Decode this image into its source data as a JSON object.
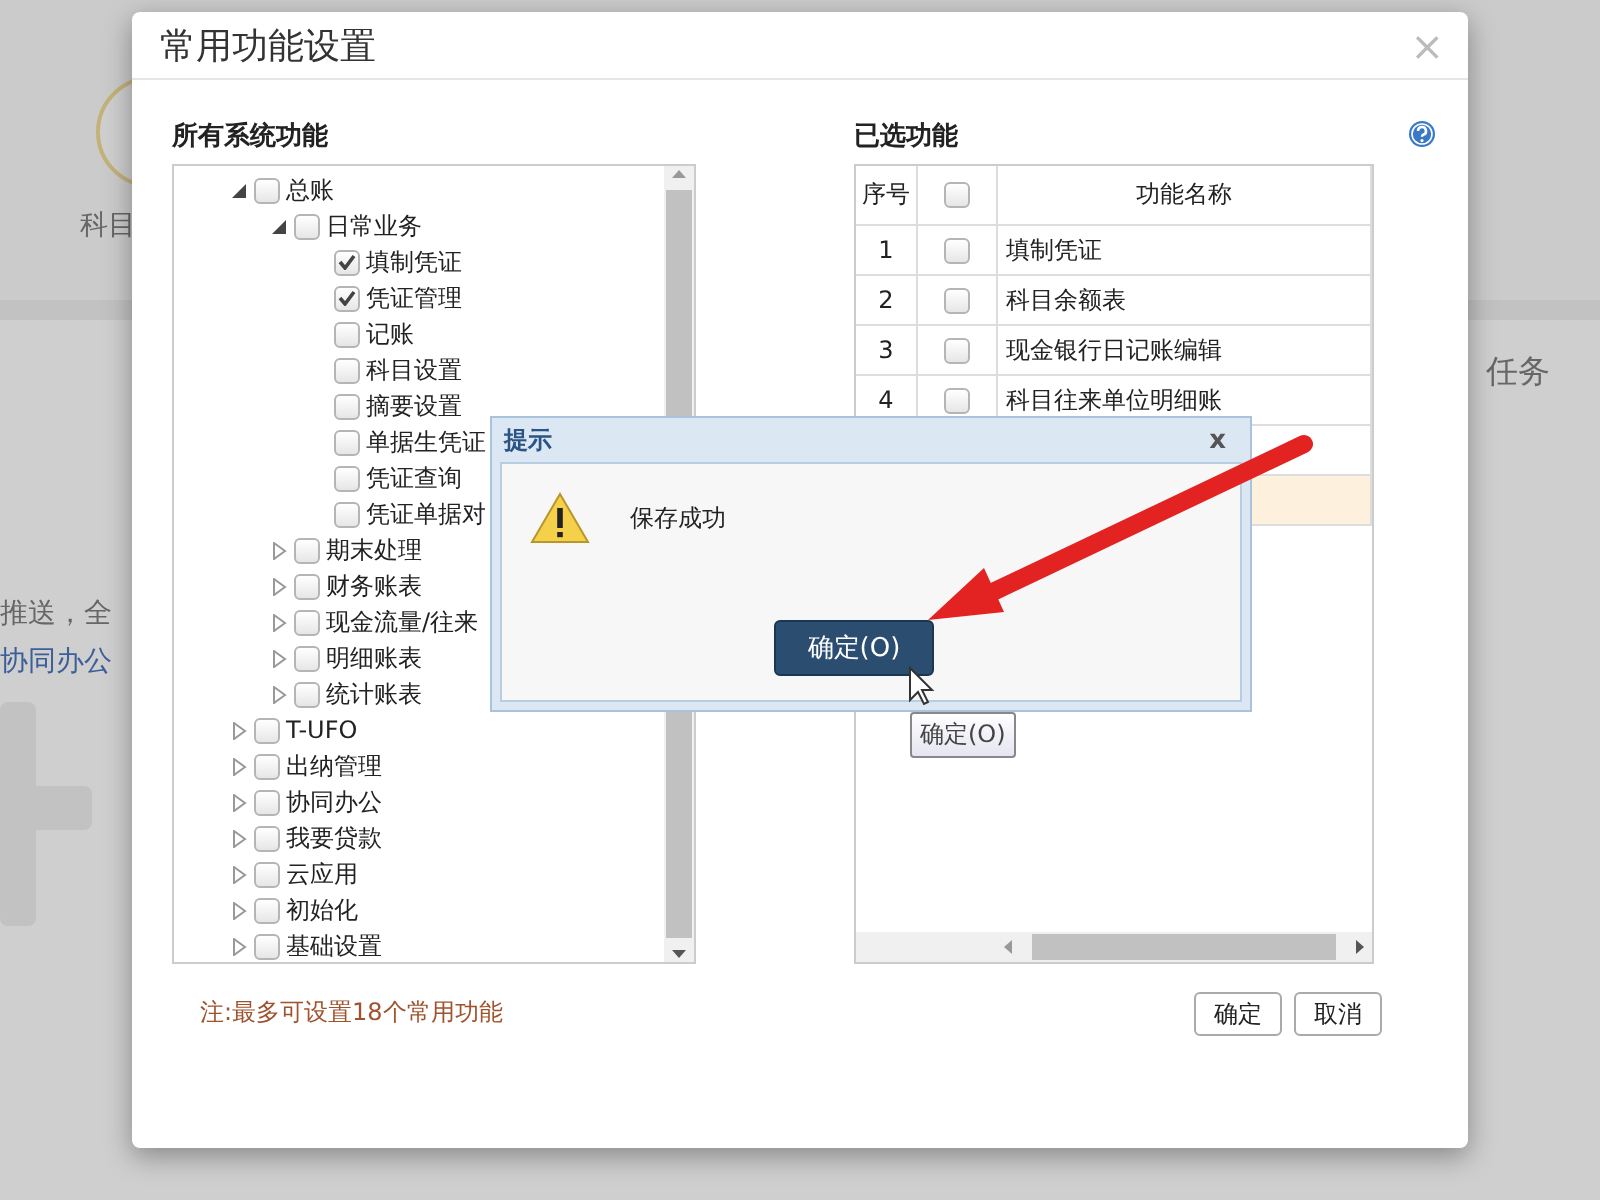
{
  "background_page": {
    "tile_label": "科目",
    "task_label": "任务",
    "notice_text": "推送，全",
    "link_text": "协同办公"
  },
  "dialog": {
    "title": "常用功能设置",
    "close": "×",
    "all_functions": {
      "heading": "所有系统功能",
      "tree": [
        {
          "label": "总账",
          "checked": false,
          "expanded": true,
          "children": [
            {
              "label": "日常业务",
              "checked": false,
              "expanded": true,
              "children": [
                {
                  "label": "填制凭证",
                  "checked": true
                },
                {
                  "label": "凭证管理",
                  "checked": true
                },
                {
                  "label": "记账",
                  "checked": false
                },
                {
                  "label": "科目设置",
                  "checked": false
                },
                {
                  "label": "摘要设置",
                  "checked": false
                },
                {
                  "label": "单据生凭证",
                  "checked": false
                },
                {
                  "label": "凭证查询",
                  "checked": false
                },
                {
                  "label": "凭证单据对",
                  "checked": false
                }
              ]
            },
            {
              "label": "期末处理",
              "checked": false,
              "expanded": false
            },
            {
              "label": "财务账表",
              "checked": false,
              "expanded": false
            },
            {
              "label": "现金流量/往来",
              "checked": false,
              "expanded": false
            },
            {
              "label": "明细账表",
              "checked": false,
              "expanded": false
            },
            {
              "label": "统计账表",
              "checked": false,
              "expanded": false
            }
          ]
        },
        {
          "label": "T-UFO",
          "checked": false,
          "expanded": false
        },
        {
          "label": "出纳管理",
          "checked": false,
          "expanded": false
        },
        {
          "label": "协同办公",
          "checked": false,
          "expanded": false
        },
        {
          "label": "我要贷款",
          "checked": false,
          "expanded": false
        },
        {
          "label": "云应用",
          "checked": false,
          "expanded": false
        },
        {
          "label": "初始化",
          "checked": false,
          "expanded": false
        },
        {
          "label": "基础设置",
          "checked": false,
          "expanded": false
        }
      ]
    },
    "selected_functions": {
      "heading": "已选功能",
      "columns": [
        "序号",
        "功能名称"
      ],
      "header_checked": false,
      "rows": [
        {
          "number": "1",
          "checked": false,
          "name": "填制凭证"
        },
        {
          "number": "2",
          "checked": false,
          "name": "科目余额表"
        },
        {
          "number": "3",
          "checked": false,
          "name": "现金银行日记账编辑"
        },
        {
          "number": "4",
          "checked": false,
          "name": "科目往来单位明细账"
        }
      ],
      "blank_rows": [
        {
          "selected": false
        },
        {
          "selected": true
        }
      ]
    },
    "note": "注:最多可设置18个常用功能",
    "buttons": [
      "确定",
      "取消"
    ]
  },
  "message_box": {
    "title": "提示",
    "close": "x",
    "message": "保存成功",
    "button": "确定(O)",
    "tooltip": "确定(O)"
  }
}
